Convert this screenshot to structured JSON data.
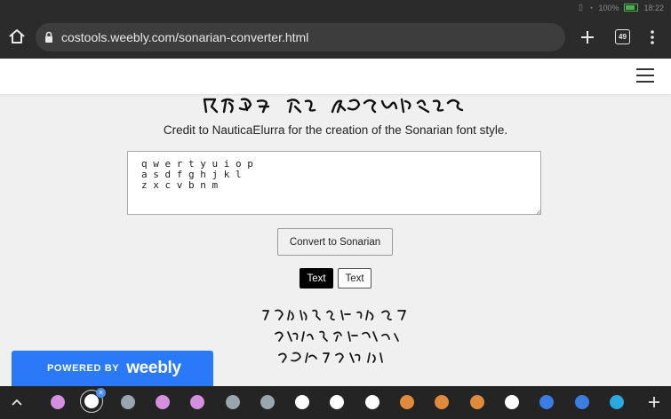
{
  "status_bar": {
    "battery_text": "100%",
    "time": "18:22"
  },
  "browser": {
    "url": "costools.weebly.com/sonarian-converter.html",
    "tab_count": "49"
  },
  "page": {
    "credit": "Credit to NauticaElurra for the creation of the Sonarian font style.",
    "textarea_value": "qwertyuiop\nasdfghjkl\nzxcvbnm",
    "convert_label": "Convert to Sonarian",
    "toggle_left": "Text",
    "toggle_right": "Text"
  },
  "weebly": {
    "powered_by": "POWERED BY",
    "brand": "weebly"
  },
  "shelf": {
    "icon_colors": [
      "#d48fe0",
      "#ffffff",
      "#9aa6ad",
      "#d48fe0",
      "#d48fe0",
      "#9aa6ad",
      "#9aa6ad",
      "#ffffff",
      "#ffffff",
      "#ffffff",
      "#e08a3c",
      "#e08a3c",
      "#e08a3c",
      "#ffffff",
      "#3b7de3",
      "#3b7de3",
      "#2aa9e0"
    ]
  }
}
